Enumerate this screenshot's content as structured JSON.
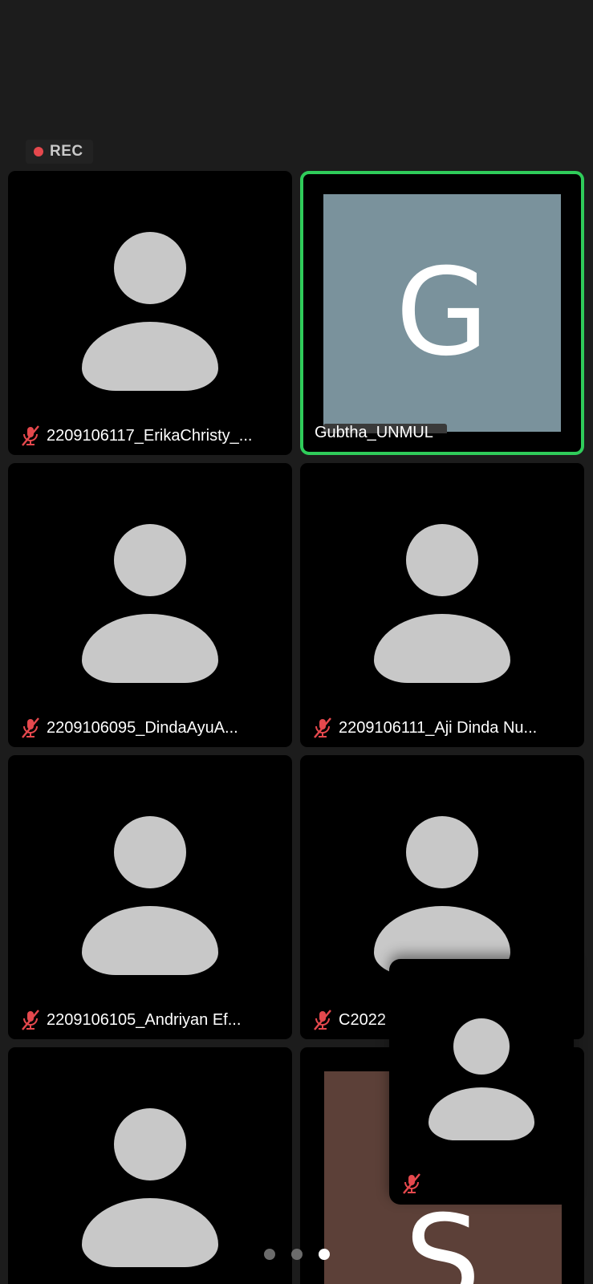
{
  "recording": {
    "label": "REC",
    "color": "#e5484d"
  },
  "tiles": [
    {
      "name": "2209106117_ErikaChristy_...",
      "muted": true,
      "avatar": "person-icon"
    },
    {
      "name": "Gubtha_UNMUL",
      "muted": false,
      "avatar_letter": "G",
      "active_speaker": true,
      "avatar_color": "#7a929c"
    },
    {
      "name": "2209106095_DindaAyuA...",
      "muted": true,
      "avatar": "person-icon"
    },
    {
      "name": "2209106111_Aji Dinda Nu...",
      "muted": true,
      "avatar": "person-icon"
    },
    {
      "name": "2209106105_Andriyan Ef...",
      "muted": true,
      "avatar": "person-icon"
    },
    {
      "name": "C2022",
      "muted": true,
      "avatar": "person-icon"
    },
    {
      "name": "",
      "muted": false,
      "avatar": "person-icon"
    },
    {
      "name": "",
      "muted": false,
      "avatar_letter": "S",
      "avatar_color": "#5c4038"
    }
  ],
  "self_view": {
    "muted": true,
    "avatar": "person-icon"
  },
  "pagination": {
    "pages": 3,
    "current": 3
  },
  "colors": {
    "active_border": "#2fcc5a",
    "muted_icon": "#e5484d",
    "background": "#1c1c1c"
  }
}
